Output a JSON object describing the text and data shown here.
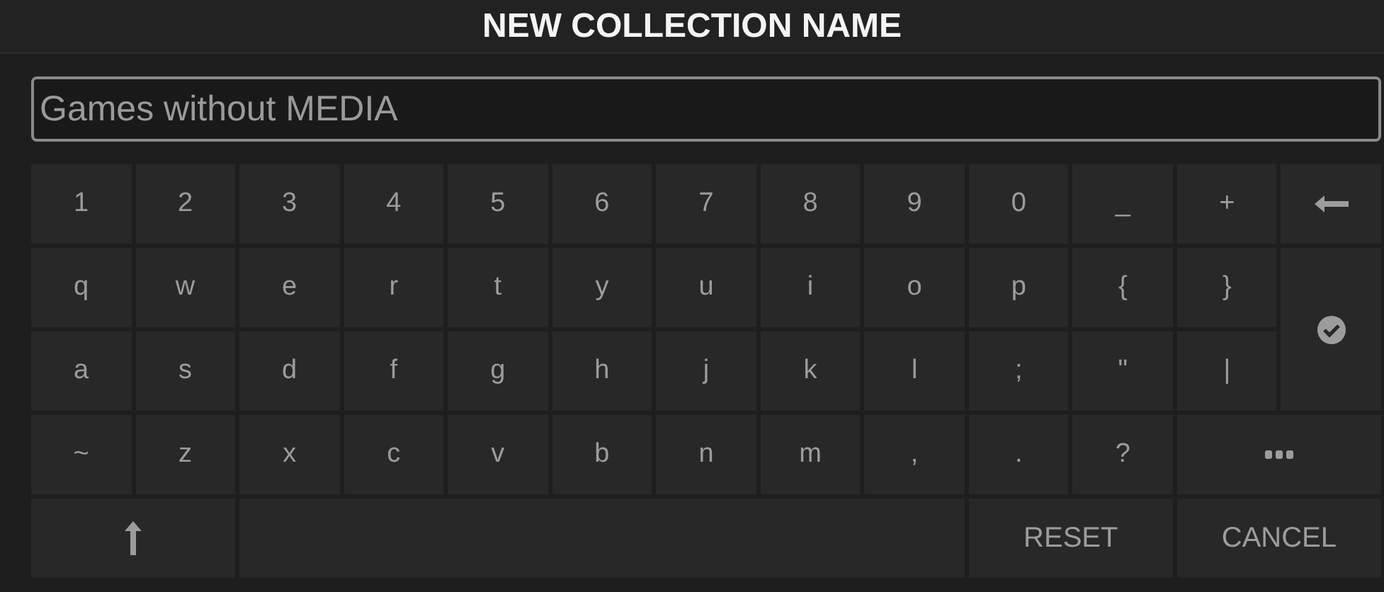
{
  "dialog": {
    "title": "NEW COLLECTION NAME"
  },
  "name_field": {
    "value": "Games without MEDIA"
  },
  "keys": [
    {
      "kind": "char",
      "label": "1"
    },
    {
      "kind": "char",
      "label": "2"
    },
    {
      "kind": "char",
      "label": "3"
    },
    {
      "kind": "char",
      "label": "4"
    },
    {
      "kind": "char",
      "label": "5"
    },
    {
      "kind": "char",
      "label": "6"
    },
    {
      "kind": "char",
      "label": "7"
    },
    {
      "kind": "char",
      "label": "8"
    },
    {
      "kind": "char",
      "label": "9"
    },
    {
      "kind": "char",
      "label": "0"
    },
    {
      "kind": "char",
      "label": "_"
    },
    {
      "kind": "char",
      "label": "+"
    },
    {
      "kind": "backspace"
    },
    {
      "kind": "char",
      "label": "q"
    },
    {
      "kind": "char",
      "label": "w"
    },
    {
      "kind": "char",
      "label": "e"
    },
    {
      "kind": "char",
      "label": "r"
    },
    {
      "kind": "char",
      "label": "t"
    },
    {
      "kind": "char",
      "label": "y"
    },
    {
      "kind": "char",
      "label": "u"
    },
    {
      "kind": "char",
      "label": "i"
    },
    {
      "kind": "char",
      "label": "o"
    },
    {
      "kind": "char",
      "label": "p"
    },
    {
      "kind": "char",
      "label": "{"
    },
    {
      "kind": "char",
      "label": "}"
    },
    {
      "kind": "enter"
    },
    {
      "kind": "char",
      "label": "a"
    },
    {
      "kind": "char",
      "label": "s"
    },
    {
      "kind": "char",
      "label": "d"
    },
    {
      "kind": "char",
      "label": "f"
    },
    {
      "kind": "char",
      "label": "g"
    },
    {
      "kind": "char",
      "label": "h"
    },
    {
      "kind": "char",
      "label": "j"
    },
    {
      "kind": "char",
      "label": "k"
    },
    {
      "kind": "char",
      "label": "l"
    },
    {
      "kind": "char",
      "label": ";"
    },
    {
      "kind": "char",
      "label": "\""
    },
    {
      "kind": "char",
      "label": "|"
    },
    {
      "kind": "char",
      "label": "~"
    },
    {
      "kind": "char",
      "label": "z"
    },
    {
      "kind": "char",
      "label": "x"
    },
    {
      "kind": "char",
      "label": "c"
    },
    {
      "kind": "char",
      "label": "v"
    },
    {
      "kind": "char",
      "label": "b"
    },
    {
      "kind": "char",
      "label": "n"
    },
    {
      "kind": "char",
      "label": "m"
    },
    {
      "kind": "char",
      "label": ","
    },
    {
      "kind": "char",
      "label": "."
    },
    {
      "kind": "char",
      "label": "?"
    },
    {
      "kind": "more"
    },
    {
      "kind": "shift"
    },
    {
      "kind": "space"
    },
    {
      "kind": "action",
      "label": "RESET"
    },
    {
      "kind": "action",
      "label": "CANCEL"
    }
  ]
}
